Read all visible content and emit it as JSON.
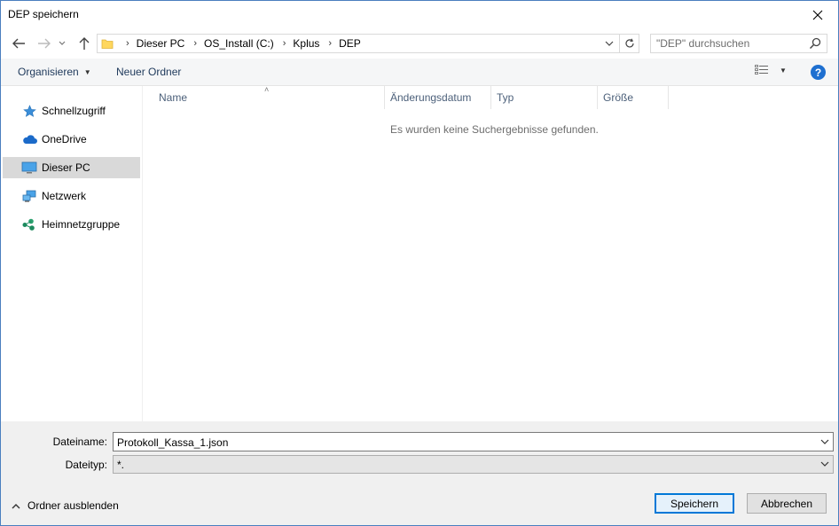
{
  "window": {
    "title": "DEP speichern"
  },
  "address": {
    "breadcrumbs": [
      "Dieser PC",
      "OS_Install (C:)",
      "Kplus",
      "DEP"
    ]
  },
  "search": {
    "placeholder": "\"DEP\" durchsuchen"
  },
  "toolbar": {
    "organize_label": "Organisieren",
    "new_folder_label": "Neuer Ordner"
  },
  "navpane": {
    "items": [
      {
        "label": "Schnellzugriff",
        "icon": "star-icon"
      },
      {
        "label": "OneDrive",
        "icon": "cloud-icon"
      },
      {
        "label": "Dieser PC",
        "icon": "computer-icon",
        "selected": true
      },
      {
        "label": "Netzwerk",
        "icon": "network-icon"
      },
      {
        "label": "Heimnetzgruppe",
        "icon": "homegroup-icon"
      }
    ]
  },
  "filelist": {
    "columns": [
      "Name",
      "Änderungsdatum",
      "Typ",
      "Größe"
    ],
    "empty_message": "Es wurden keine Suchergebnisse gefunden."
  },
  "form": {
    "filename_label": "Dateiname:",
    "filename_value": "Protokoll_Kassa_1.json",
    "filetype_label": "Dateityp:",
    "filetype_value": "*."
  },
  "footer": {
    "hide_folders_label": "Ordner ausblenden",
    "save_label": "Speichern",
    "cancel_label": "Abbrechen"
  },
  "colors": {
    "accent": "#0078d7",
    "help": "#1e6fd0",
    "selected_bg": "#d9d9d9"
  }
}
